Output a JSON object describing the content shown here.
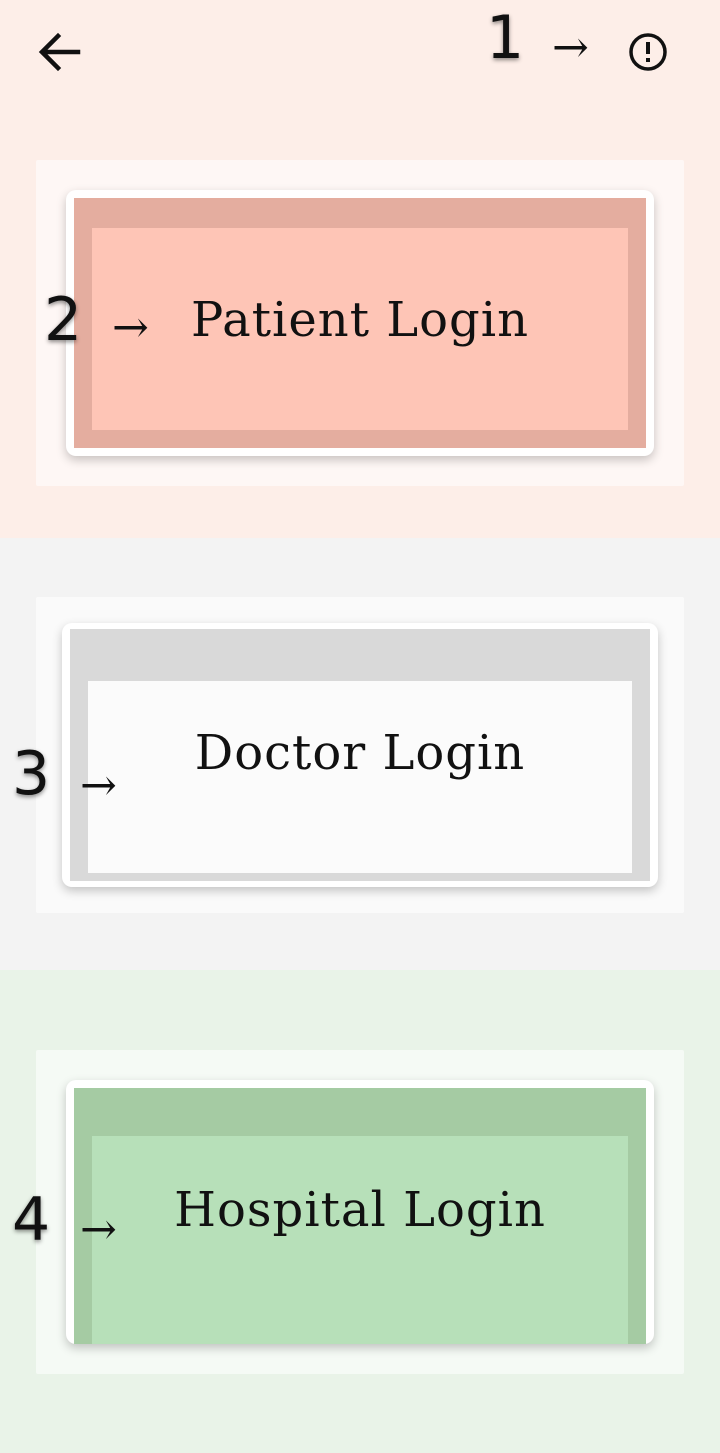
{
  "topbar": {
    "back_icon": "arrow-back-icon",
    "info_icon": "info-circle-icon",
    "annotation_number": "1",
    "annotation_arrow": "→"
  },
  "cards": [
    {
      "annotation_number": "2",
      "annotation_arrow": "→",
      "label": "Patient Login",
      "band_color": "#e4ad9f",
      "inner_color": "#fec5b6"
    },
    {
      "annotation_number": "3",
      "annotation_arrow": "→",
      "label": "Doctor Login",
      "band_color": "#d9d9d9",
      "inner_color": "#fbfbfb"
    },
    {
      "annotation_number": "4",
      "annotation_arrow": "→",
      "label": "Hospital Login",
      "band_color": "#a5cba3",
      "inner_color": "#b7e0b9"
    }
  ],
  "colors": {
    "patient_section_bg": "#fdeee8",
    "doctor_section_bg": "#f3f3f3",
    "hospital_section_bg": "#e9f3e8"
  }
}
